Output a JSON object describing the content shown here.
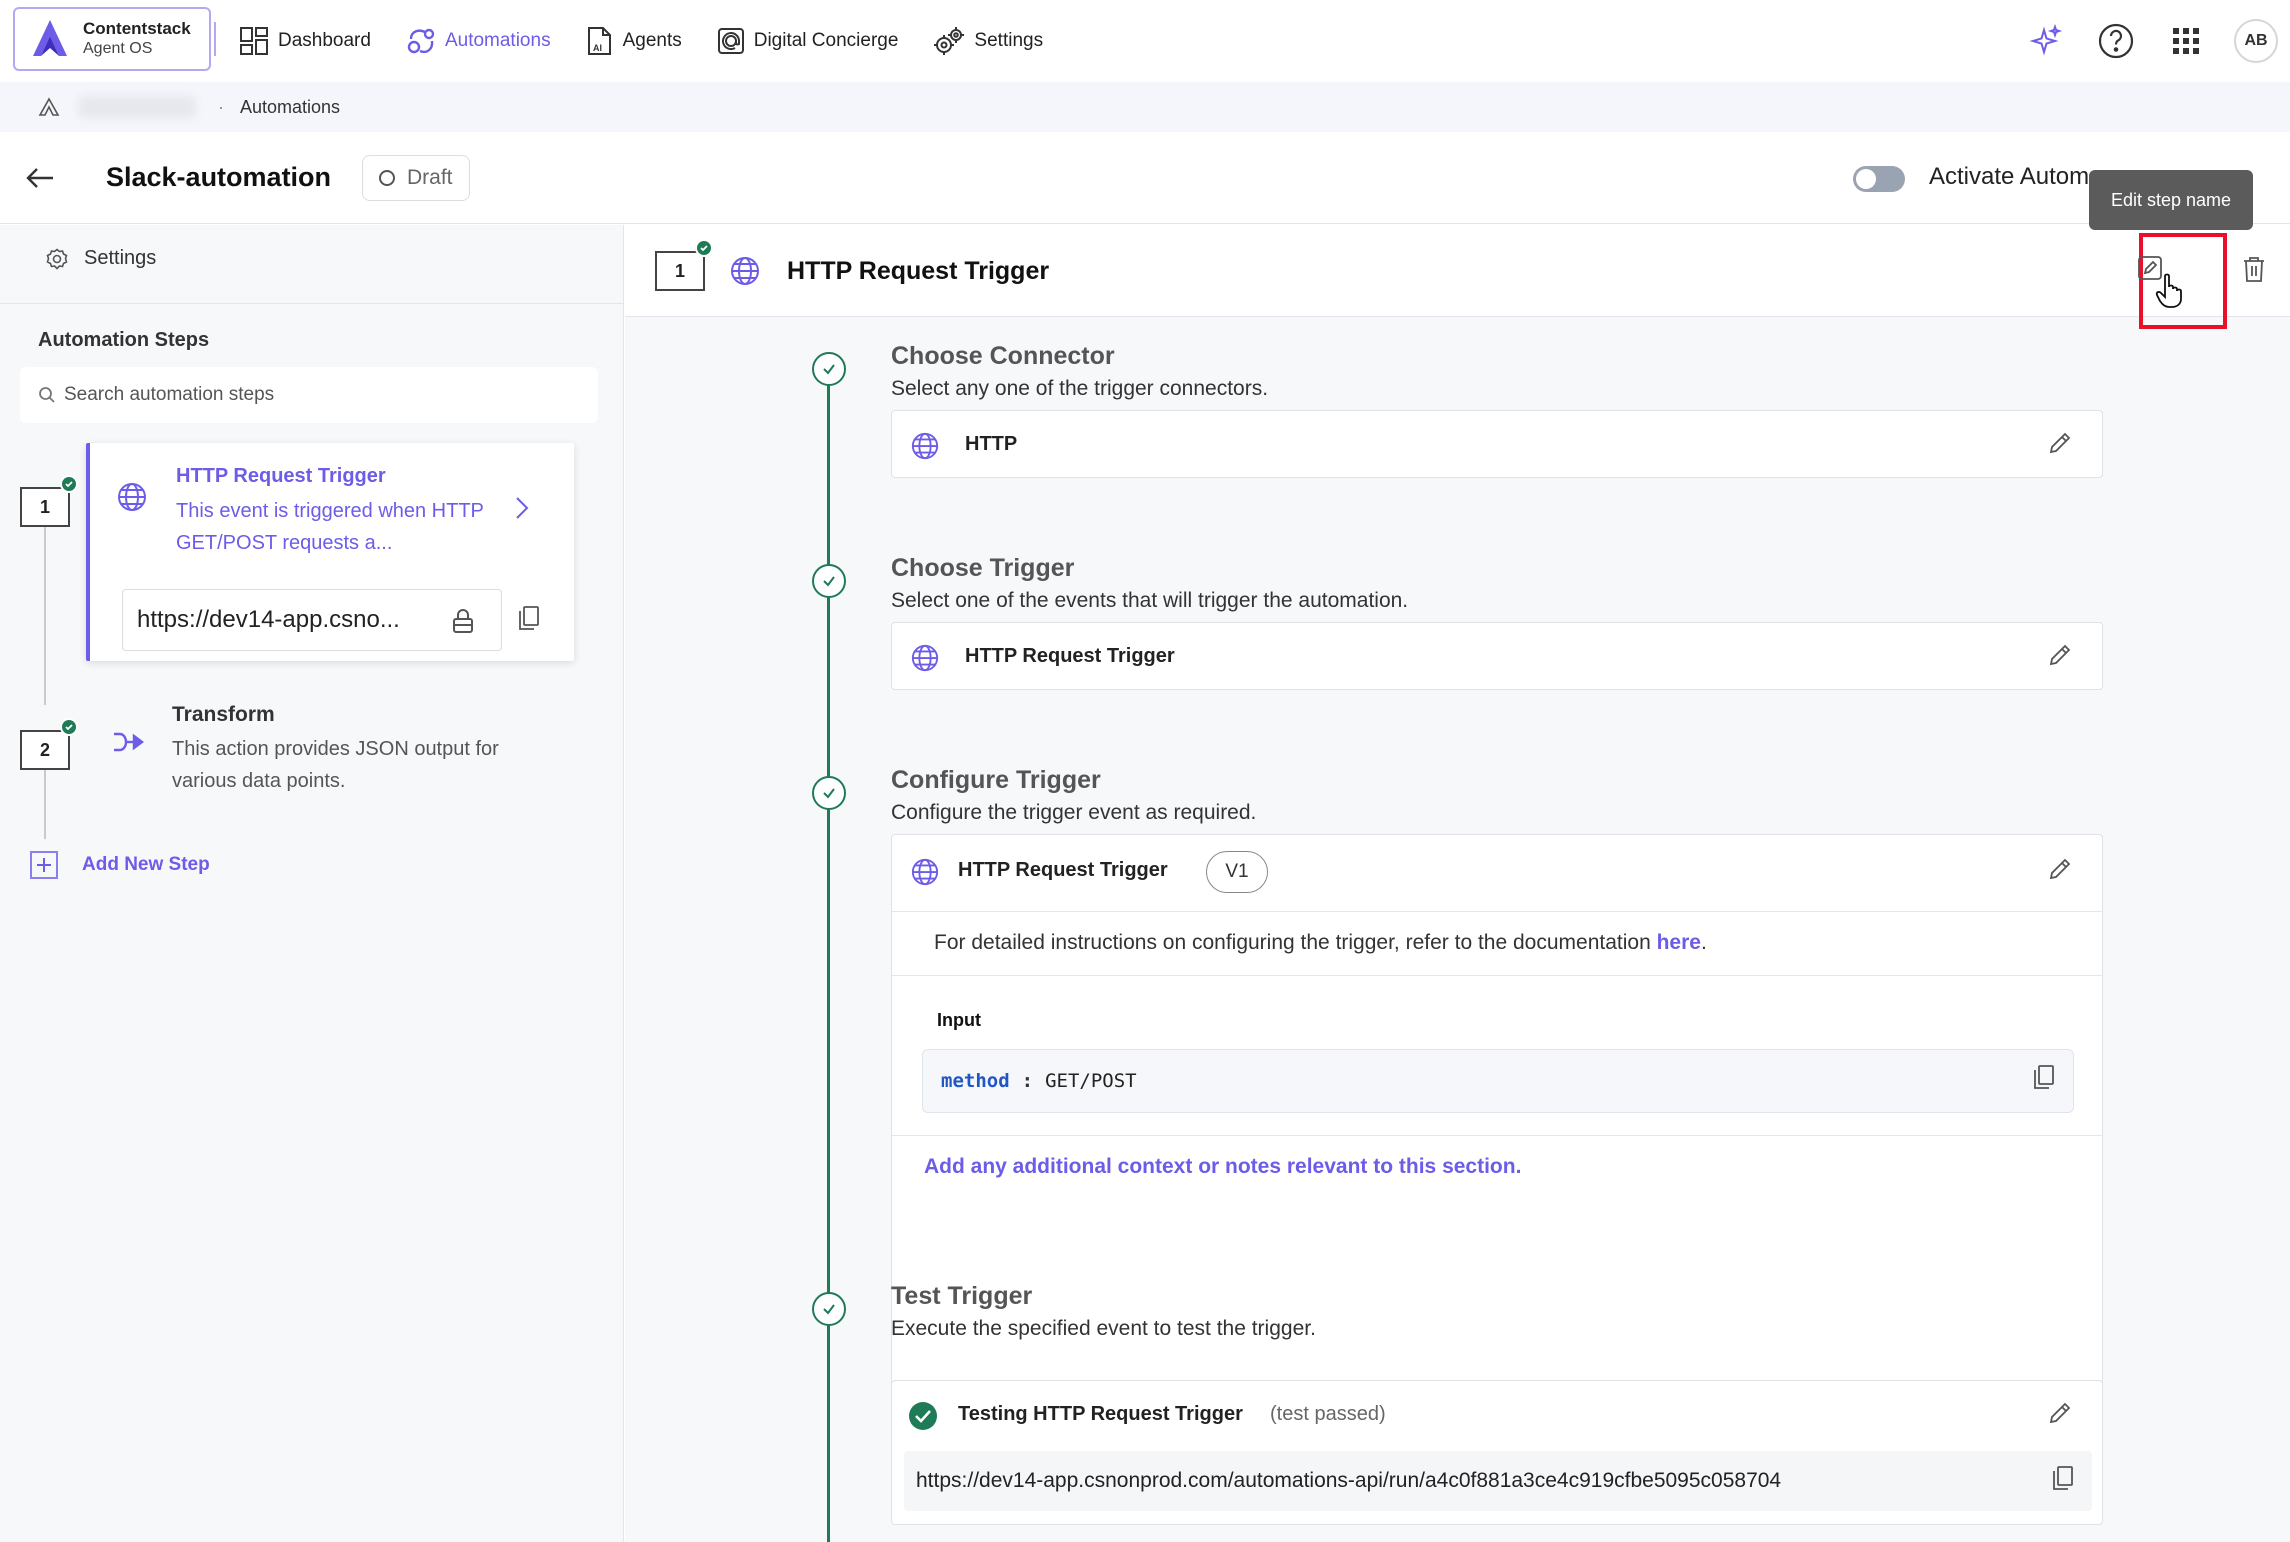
{
  "brand": {
    "name": "Contentstack",
    "sub": "Agent OS"
  },
  "nav": {
    "items": [
      {
        "label": "Dashboard",
        "icon": "dashboard-icon",
        "active": false
      },
      {
        "label": "Automations",
        "icon": "automations-icon",
        "active": true
      },
      {
        "label": "Agents",
        "icon": "agents-icon",
        "active": false
      },
      {
        "label": "Digital Concierge",
        "icon": "digital-concierge-icon",
        "active": false
      },
      {
        "label": "Settings",
        "icon": "settings-icon",
        "active": false
      }
    ],
    "avatar_initials": "AB"
  },
  "breadcrumb": {
    "current": "Automations"
  },
  "header": {
    "title": "Slack-automation",
    "status": "Draft",
    "activate_label": "Activate Automation",
    "tooltip": "Edit step name"
  },
  "sidebar": {
    "settings_label": "Settings",
    "heading": "Automation Steps",
    "search_placeholder": "Search automation steps",
    "steps": [
      {
        "number": "1",
        "title": "HTTP Request Trigger",
        "description": "This event is triggered when HTTP GET/POST requests a...",
        "url": "https://dev14-app.csno..."
      },
      {
        "number": "2",
        "title": "Transform",
        "description": "This action provides JSON output for various data points."
      }
    ],
    "add_step_label": "Add New Step"
  },
  "main": {
    "step_number": "1",
    "step_title": "HTTP Request Trigger",
    "sections": {
      "connector": {
        "title": "Choose Connector",
        "subtitle": "Select any one of the trigger connectors.",
        "value": "HTTP"
      },
      "trigger": {
        "title": "Choose Trigger",
        "subtitle": "Select one of the events that will trigger the automation.",
        "value": "HTTP Request Trigger"
      },
      "configure": {
        "title": "Configure Trigger",
        "subtitle": "Configure the trigger event as required.",
        "value": "HTTP Request Trigger",
        "version": "V1",
        "doc_text": "For detailed instructions on configuring the trigger, refer to the documentation ",
        "doc_link": "here",
        "doc_period": ".",
        "input_label": "Input",
        "input_key": "method",
        "input_sep": ":",
        "input_value": "GET/POST",
        "notes_link": "Add any additional context or notes relevant to this section."
      },
      "test": {
        "title": "Test Trigger",
        "subtitle": "Execute the specified event to test the trigger.",
        "label": "Testing HTTP Request Trigger",
        "status": "(test passed)",
        "url": "https://dev14-app.csnonprod.com/automations-api/run/a4c0f881a3ce4c919cfbe5095c058704"
      }
    }
  },
  "colors": {
    "accent": "#6c5ce7",
    "success": "#1f7a57",
    "highlight": "#e8102a"
  }
}
